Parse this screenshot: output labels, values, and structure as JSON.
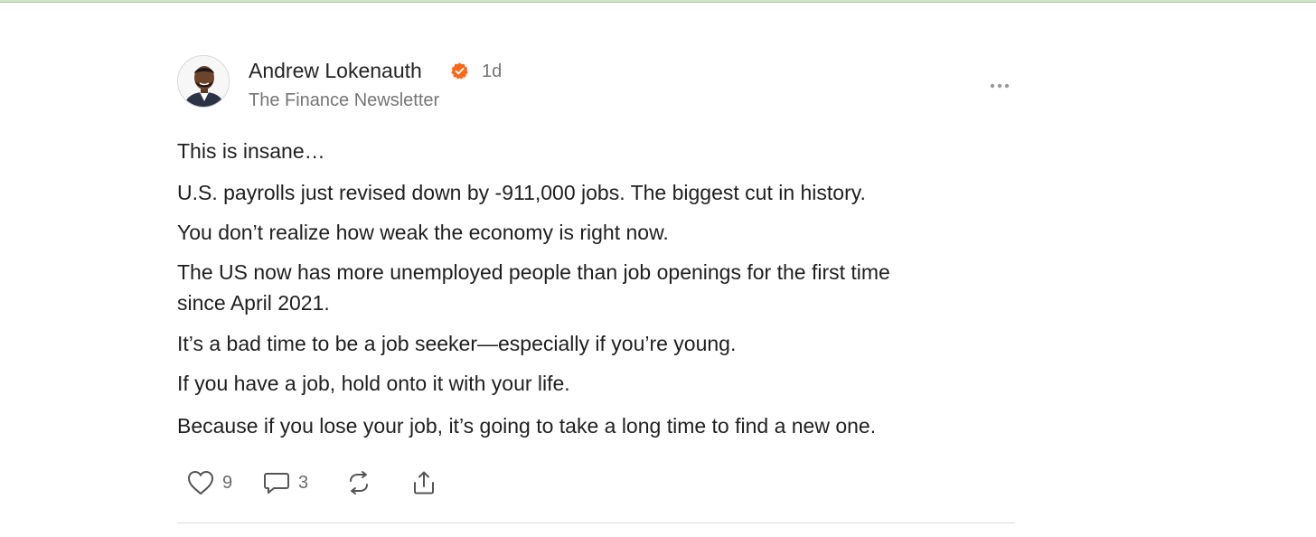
{
  "post": {
    "author": {
      "name": "Andrew Lokenauth",
      "verified_icon": "verified-check-icon",
      "time": "1d",
      "publication": "The Finance Newsletter"
    },
    "more_icon": "more-horizontal-icon",
    "paragraphs": [
      "This is insane…",
      "U.S. payrolls just revised down by -911,000 jobs. The biggest cut in history.",
      "You don’t realize how weak the economy is right now.",
      "The US now has more unemployed people than job openings for the first time",
      "since April 2021.",
      "It’s a bad time to be a job seeker—especially if you’re young.",
      "If you have a job, hold onto it with your life.",
      "Because if you lose your job, it’s going to take a long time to find a new one."
    ],
    "actions": {
      "like": {
        "icon": "heart-icon",
        "count": "9"
      },
      "comment": {
        "icon": "comment-icon",
        "count": "3"
      },
      "restack": {
        "icon": "restack-icon"
      },
      "share": {
        "icon": "share-icon"
      }
    }
  },
  "colors": {
    "accent": "#ff6719",
    "text": "#1f1f1f",
    "muted": "#757575"
  }
}
